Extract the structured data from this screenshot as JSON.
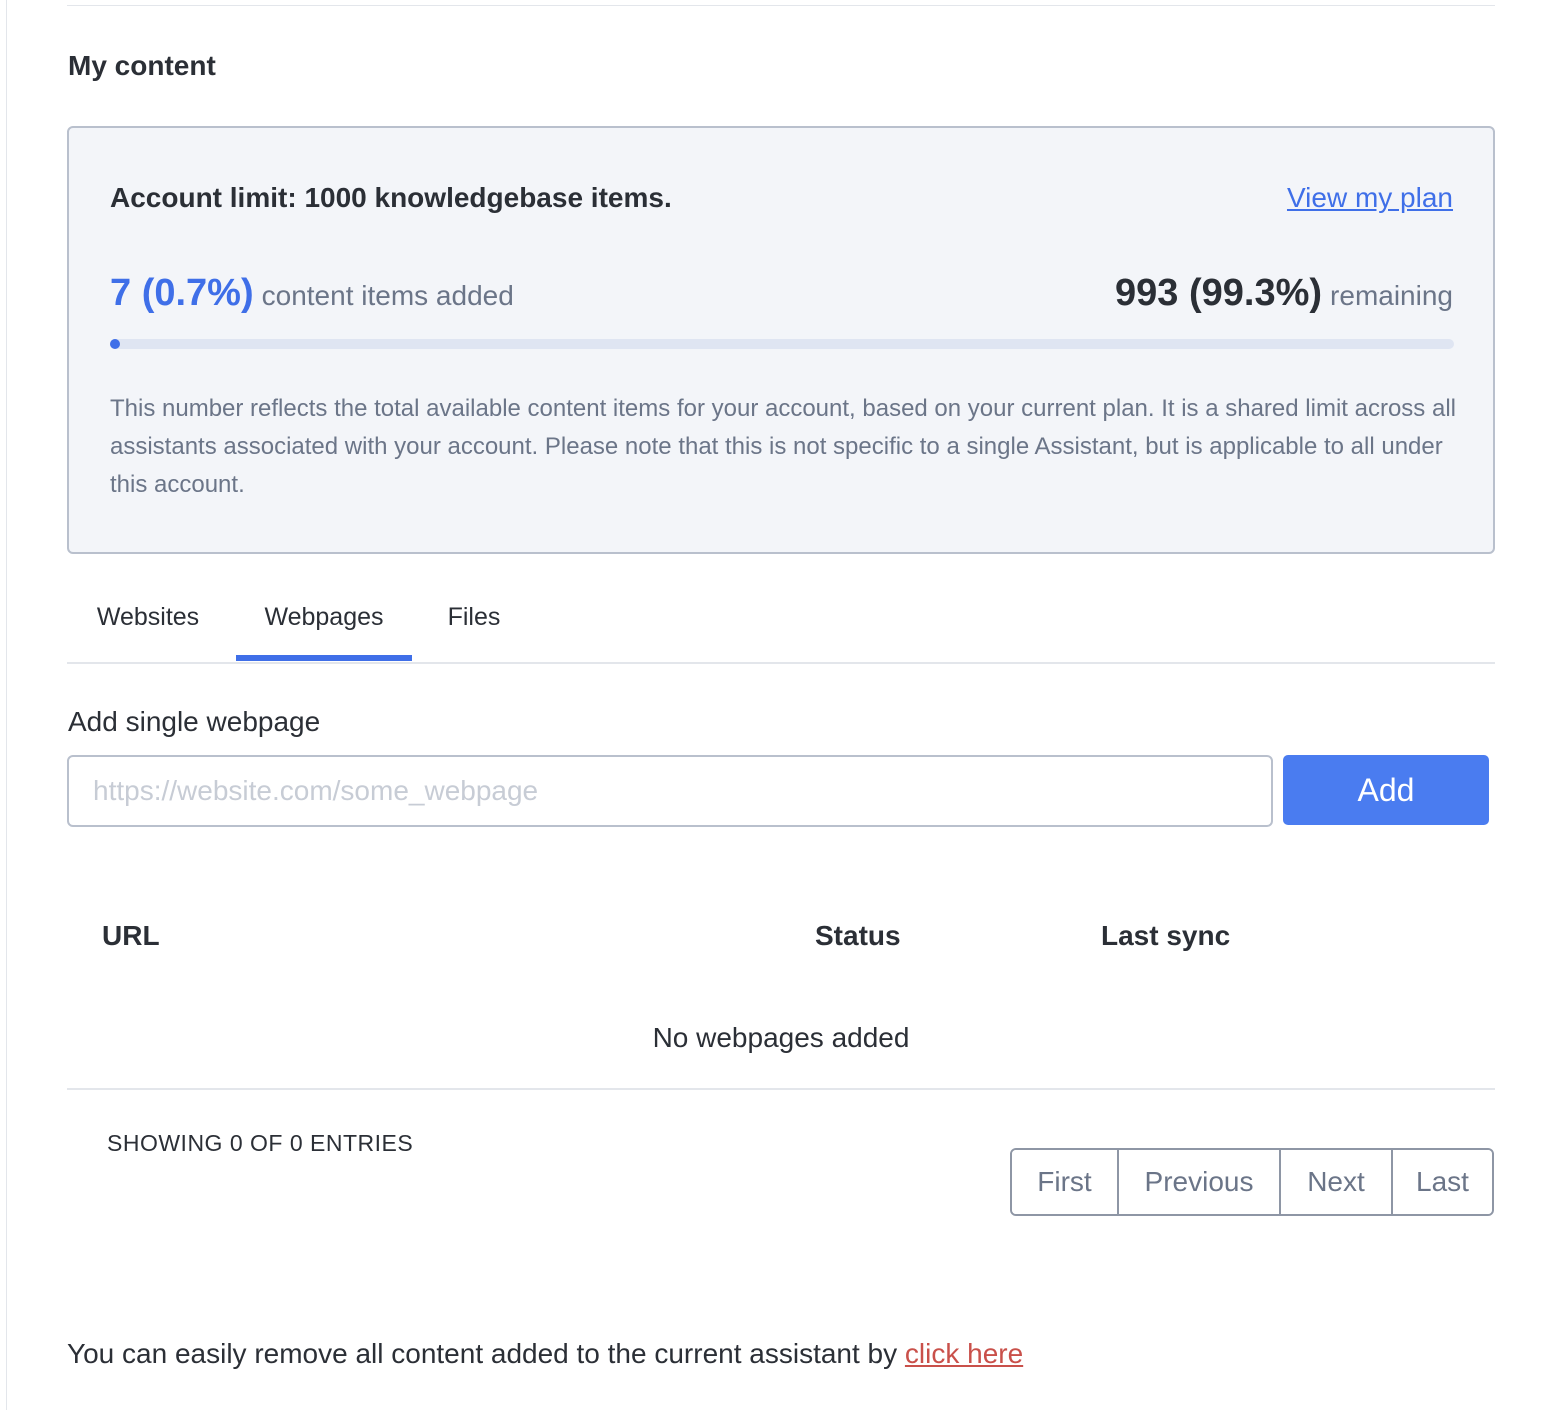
{
  "section_title": "My content",
  "limit_card": {
    "title": "Account limit: 1000 knowledgebase items.",
    "plan_link": "View my plan",
    "added_value": "7 (0.7%)",
    "added_label": "content items added",
    "remaining_value": "993 (99.3%)",
    "remaining_label": "remaining",
    "usage_fraction": 0.007,
    "note": "This number reflects the total available content items for your account, based on your current plan. It is a shared limit across all assistants associated with your account. Please note that this is not specific to a single Assistant, but is applicable to all under this account."
  },
  "tabs": [
    {
      "label": "Websites",
      "active": false
    },
    {
      "label": "Webpages",
      "active": true
    },
    {
      "label": "Files",
      "active": false
    }
  ],
  "add_form": {
    "label": "Add single webpage",
    "input_value": "",
    "placeholder": "https://website.com/some_webpage",
    "button_label": "Add"
  },
  "table": {
    "columns": [
      "URL",
      "Status",
      "Last sync"
    ],
    "rows": [],
    "empty_message": "No webpages added"
  },
  "pagination": {
    "summary": "SHOWING 0 OF 0 ENTRIES",
    "first": "First",
    "previous": "Previous",
    "next": "Next",
    "last": "Last"
  },
  "footer": {
    "text": "You can easily remove all content added to the current assistant by",
    "link": "click here"
  },
  "colors": {
    "accent": "#3f6fe8",
    "button": "#4a7cf0",
    "danger_link": "#c9504a",
    "card_bg": "#f3f5f9"
  }
}
